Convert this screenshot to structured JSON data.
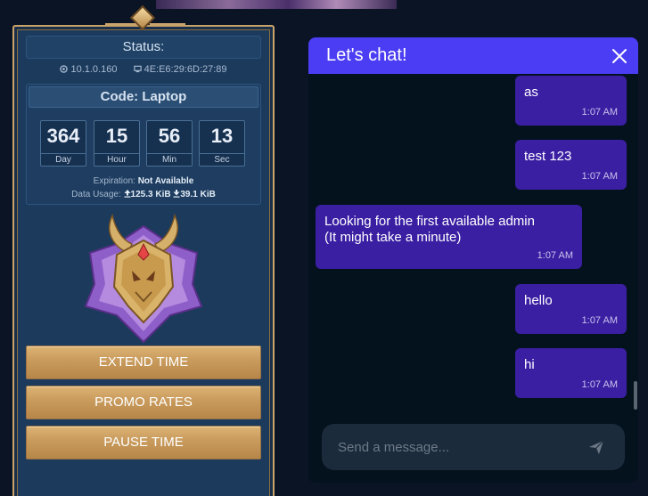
{
  "portal": {
    "status_label": "Status:",
    "ip_address": "10.1.0.160",
    "mac_address": "4E:E6:29:6D:27:89",
    "code_title": "Code: Laptop",
    "timer": [
      {
        "value": "364",
        "unit": "Day"
      },
      {
        "value": "15",
        "unit": "Hour"
      },
      {
        "value": "56",
        "unit": "Min"
      },
      {
        "value": "13",
        "unit": "Sec"
      }
    ],
    "expiration_label": "Expiration:",
    "expiration_value": "Not Available",
    "usage_label": "Data Usage:",
    "upload": "125.3 KiB",
    "download": "39.1 KiB",
    "buttons": {
      "extend": "EXTEND TIME",
      "promo": "PROMO RATES",
      "pause": "PAUSE TIME"
    },
    "colors": {
      "panel_bg": "#1c3a5c",
      "gold": "#c9a36a"
    }
  },
  "chat": {
    "title": "Let's chat!",
    "close_icon": "close-icon",
    "messages": [
      {
        "side": "right",
        "text": "as",
        "time": "1:07 AM"
      },
      {
        "side": "right",
        "text": "test 123",
        "time": "1:07 AM"
      },
      {
        "side": "left",
        "text": "Looking for the first available admin\n(It might take a minute)",
        "time": "1:07 AM"
      },
      {
        "side": "right",
        "text": "hello",
        "time": "1:07 AM"
      },
      {
        "side": "right",
        "text": "hi",
        "time": "1:07 AM"
      }
    ],
    "input_placeholder": "Send a message...",
    "send_icon": "send-icon",
    "colors": {
      "header": "#4b3df3",
      "bubble": "#3a1fa3",
      "background": "#04121d"
    }
  }
}
